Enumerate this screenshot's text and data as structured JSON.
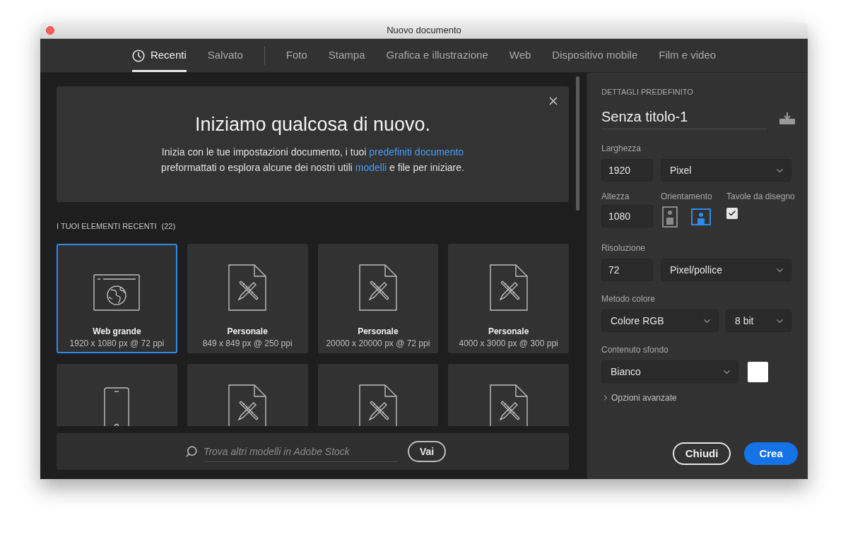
{
  "window": {
    "title": "Nuovo documento"
  },
  "tabs": {
    "primary": [
      {
        "label": "Recenti",
        "selected": true,
        "kind": "recent"
      },
      {
        "label": "Salvato",
        "selected": false,
        "kind": "plain"
      }
    ],
    "categories": [
      {
        "label": "Foto",
        "selected": false
      },
      {
        "label": "Stampa",
        "selected": false
      },
      {
        "label": "Grafica e illustrazione",
        "selected": false
      },
      {
        "label": "Web",
        "selected": false
      },
      {
        "label": "Dispositivo mobile",
        "selected": false
      },
      {
        "label": "Film e video",
        "selected": false
      }
    ]
  },
  "banner": {
    "title": "Iniziamo qualcosa di nuovo.",
    "lines": [
      [
        {
          "text": "Inizia con le tue impostazioni documento, i tuoi ",
          "link": false
        },
        {
          "text": "predefiniti documento",
          "link": true
        }
      ],
      [
        {
          "text": "preformattati o esplora alcune dei nostri utili ",
          "link": false
        },
        {
          "text": "modelli",
          "link": true
        },
        {
          "text": " e file per iniziare.",
          "link": false
        }
      ]
    ]
  },
  "recent": {
    "heading": "I TUOI ELEMENTI RECENTI",
    "count": "(22)",
    "items": [
      {
        "kind": "web",
        "name": "Web grande",
        "size": "1920 x 1080 px @ 72 ppi",
        "selected": true
      },
      {
        "kind": "custom",
        "name": "Personale",
        "size": "849 x 849 px @ 250 ppi",
        "selected": false
      },
      {
        "kind": "custom",
        "name": "Personale",
        "size": "20000 x 20000 px @ 72 ppi",
        "selected": false
      },
      {
        "kind": "custom",
        "name": "Personale",
        "size": "4000 x 3000 px @ 300 ppi",
        "selected": false
      },
      {
        "kind": "mobile",
        "selected": false
      },
      {
        "kind": "custom",
        "selected": false
      },
      {
        "kind": "custom",
        "selected": false
      },
      {
        "kind": "custom",
        "selected": false
      }
    ]
  },
  "search": {
    "placeholder": "Trova altri modelli in Adobe Stock",
    "button": "Vai"
  },
  "details": {
    "heading": "DETTAGLI PREDEFINITO",
    "name": "Senza titolo-1",
    "width": {
      "label": "Larghezza",
      "value": "1920",
      "unit": "Pixel"
    },
    "height": {
      "label": "Altezza",
      "value": "1080"
    },
    "orientation": {
      "label": "Orientamento",
      "options": [
        {
          "kind": "portrait",
          "selected": false
        },
        {
          "kind": "landscape",
          "selected": true
        }
      ]
    },
    "artboards": {
      "label": "Tavole da disegno",
      "checked": true
    },
    "resolution": {
      "label": "Risoluzione",
      "value": "72",
      "unit": "Pixel/pollice"
    },
    "color_mode": {
      "label": "Metodo colore",
      "mode": "Colore RGB",
      "depth": "8 bit"
    },
    "background": {
      "label": "Contenuto sfondo",
      "value": "Bianco"
    },
    "advanced": {
      "label": "Opzioni avanzate",
      "expanded": false
    }
  },
  "buttons": [
    {
      "label": "Chiudi",
      "kind": "secondary"
    },
    {
      "label": "Crea",
      "kind": "primary"
    }
  ]
}
